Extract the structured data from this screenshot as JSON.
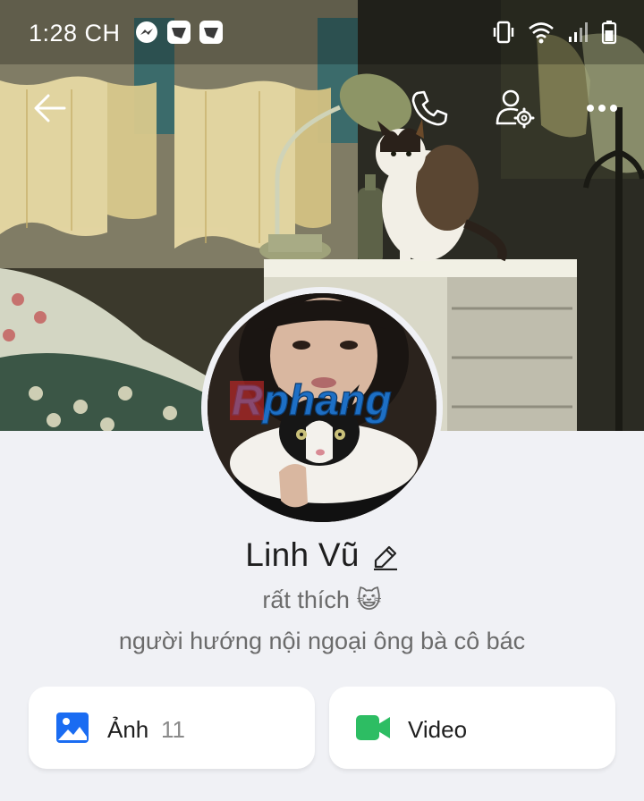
{
  "status_bar": {
    "time": "1:28 CH",
    "left_icons": [
      "messenger-icon",
      "app-notification-icon",
      "app-notification-icon"
    ],
    "right_icons": [
      "vibrate-icon",
      "wifi-icon",
      "signal-icon",
      "battery-icon"
    ]
  },
  "nav": {
    "icons": [
      "back-arrow-icon",
      "phone-icon",
      "user-settings-icon",
      "more-icon"
    ]
  },
  "cover": {
    "watermark": "Rphang"
  },
  "profile": {
    "name": "Linh Vũ",
    "status": "rất thích 😺",
    "bio": "người hướng nội ngoại ông bà cô bác"
  },
  "media": {
    "photos_label": "Ảnh",
    "photos_count": "11",
    "video_label": "Video"
  },
  "colors": {
    "photos_icon": "#1a6cf2",
    "video_icon": "#2dbd63",
    "background": "#f0f1f5"
  }
}
